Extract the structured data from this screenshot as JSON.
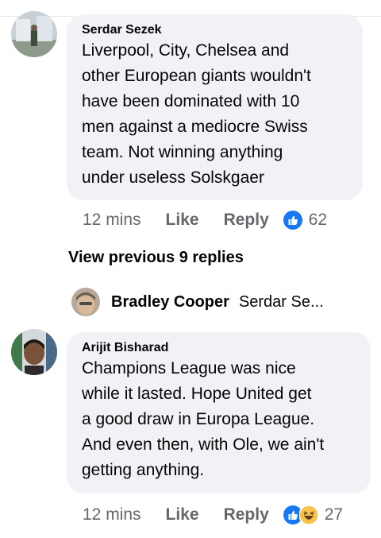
{
  "comment1": {
    "author": "Serdar Sezek",
    "text": "Liverpool, City, Chelsea and\nother European giants wouldn't\nhave been dominated with 10\nmen against a mediocre Swiss\nteam. Not winning anything\nunder useless Solskgaer",
    "time": "12 mins",
    "like_label": "Like",
    "reply_label": "Reply",
    "reaction_count": "62",
    "reaction_icons": [
      "like-icon"
    ]
  },
  "view_previous": "View previous 9 replies",
  "reply_preview": {
    "author": "Bradley Cooper",
    "snippet": "Serdar Se..."
  },
  "comment2": {
    "author": "Arijit Bisharad",
    "text": "Champions League was nice\nwhile it lasted. Hope United get\na good draw in Europa League.\nAnd even then, with Ole, we ain't\ngetting anything.",
    "time": "12 mins",
    "like_label": "Like",
    "reply_label": "Reply",
    "reaction_count": "27",
    "reaction_icons": [
      "like-icon",
      "haha-icon"
    ]
  },
  "colors": {
    "bubble": "#f0f2f5",
    "like_blue": "#1877f2",
    "meta_gray": "#65676b",
    "haha_yellow": "#f7c34a"
  }
}
